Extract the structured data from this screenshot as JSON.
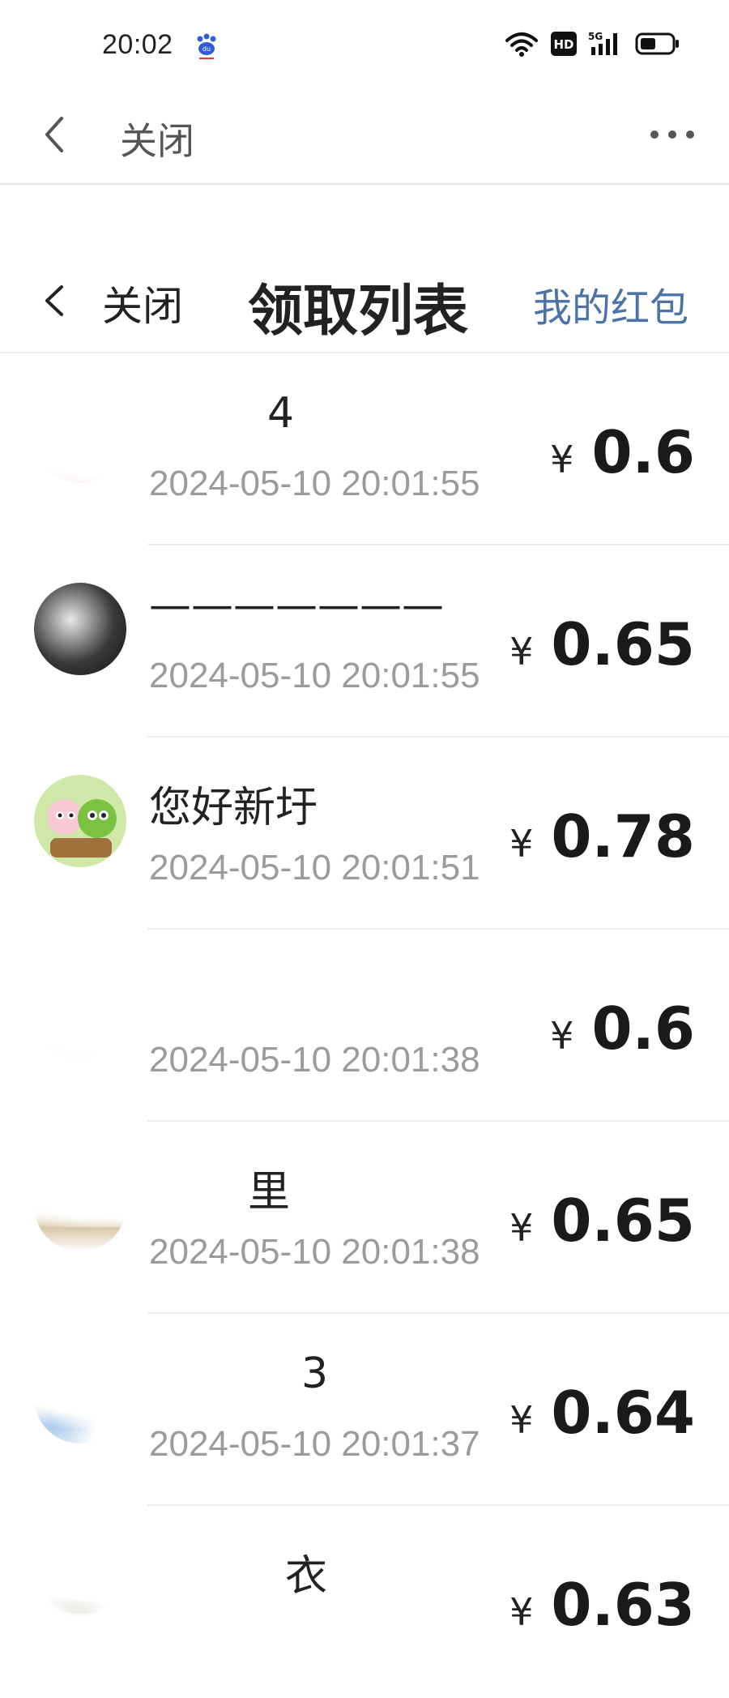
{
  "status_bar": {
    "time": "20:02",
    "icons": [
      "baidu-icon",
      "wifi-icon",
      "hd-icon",
      "5g-signal-icon",
      "battery-icon"
    ],
    "network_badge": "HD",
    "signal_label": "5G"
  },
  "browser_bar": {
    "close_label": "关闭",
    "more_icon": "more-dots-icon"
  },
  "header": {
    "close_label": "关闭",
    "title": "领取列表",
    "my_redpacket_label": "我的红包"
  },
  "currency_symbol": "¥",
  "records": [
    {
      "name": "4",
      "time": "2024-05-10 20:01:55",
      "amount": "0.6",
      "avatar_color": "#f4c7c3"
    },
    {
      "name": "———————",
      "time": "2024-05-10 20:01:55",
      "amount": "0.65",
      "avatar_color": "#3a3a3a"
    },
    {
      "name": "您好新圩",
      "time": "2024-05-10 20:01:51",
      "amount": "0.78",
      "avatar_color": "#8bc34a"
    },
    {
      "name": "",
      "time": "2024-05-10 20:01:38",
      "amount": "0.6",
      "avatar_color": "#ffffff"
    },
    {
      "name": "里",
      "time": "2024-05-10 20:01:38",
      "amount": "0.65",
      "avatar_color": "#d9c8a9"
    },
    {
      "name": "3",
      "time": "2024-05-10 20:01:37",
      "amount": "0.64",
      "avatar_color": "#9fc3e6"
    },
    {
      "name": "衣",
      "time": "",
      "amount": "0.63",
      "avatar_color": "#556b4a"
    }
  ]
}
